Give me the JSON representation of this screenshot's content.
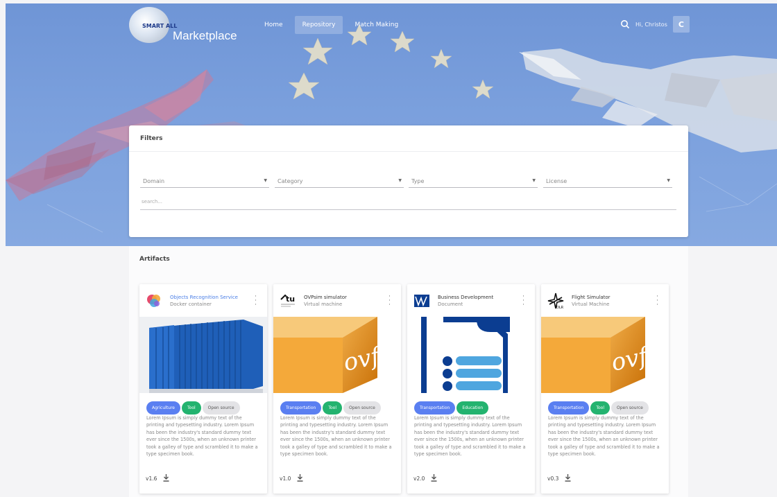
{
  "brand": {
    "logo_text": "SMART ALL",
    "title": "Marketplace"
  },
  "nav": {
    "items": [
      "Home",
      "Repository",
      "Match Making"
    ],
    "active": "Repository"
  },
  "user": {
    "greeting": "Hi, Christos",
    "initial": "C"
  },
  "filters": {
    "title": "Filters",
    "selects": [
      "Domain",
      "Category",
      "Type",
      "License"
    ],
    "search_placeholder": "search..."
  },
  "artifacts": {
    "title": "Artifacts",
    "items": [
      {
        "name": "Objects Recognition Service",
        "kind": "Docker container",
        "tags": [
          "Agriculture",
          "Tool",
          "Open source"
        ],
        "description": "Lorem Ipsum is simply dummy text of the printing and typesetting industry. Lorem Ipsum has been the industry's standard dummy text ever since the 1500s, when an unknown printer took a galley of type and scrambled it to make a type specimen book.",
        "version": "v1.6",
        "icon": "objects-recognition-logo",
        "image": "shipping-container"
      },
      {
        "name": "OVPsim simulator",
        "kind": "Virtual machine",
        "tags": [
          "Transportation",
          "Tool",
          "Open source"
        ],
        "description": "Lorem Ipsum is simply dummy text of the printing and typesetting industry. Lorem Ipsum has been the industry's standard dummy text ever since the 1500s, when an unknown printer took a galley of type and scrambled it to make a type specimen book.",
        "version": "v1.0",
        "icon": "tu-logo",
        "image": "ovf-box",
        "image_text": "ovf"
      },
      {
        "name": "Business Development",
        "kind": "Document",
        "tags": [
          "Transportation",
          "Education"
        ],
        "description": "Lorem Ipsum is simply dummy text of the printing and typesetting industry. Lorem Ipsum has been the industry's standard dummy text ever since the 1500s, when an unknown printer took a galley of type and scrambled it to make a type specimen book.",
        "version": "v2.0",
        "icon": "vw-logo",
        "image": "document-illustration"
      },
      {
        "name": "Flight Simulator",
        "kind": "Virtual Machine",
        "tags": [
          "Transportation",
          "Tool",
          "Open source"
        ],
        "description": "Lorem Ipsum is simply dummy text of the printing and typesetting industry. Lorem Ipsum has been the industry's standard dummy text ever since the 1500s, when an unknown printer took a galley of type and scrambled it to make a type specimen book.",
        "version": "v0.3",
        "icon": "dlr-logo",
        "image": "ovf-box",
        "image_text": "ovf"
      }
    ]
  },
  "colors": {
    "hero": "#7ba0dd",
    "tag_blue": "#5a7ff1",
    "tag_green": "#23b36f",
    "tag_grey": "#e3e3e6",
    "link": "#4a7ee6"
  }
}
